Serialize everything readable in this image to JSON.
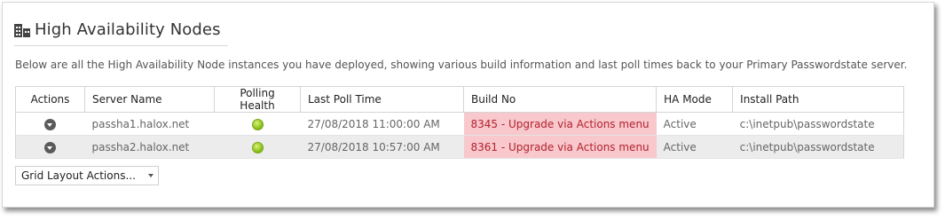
{
  "header": {
    "title": "High Availability Nodes",
    "icon": "building-icon"
  },
  "description": "Below are all the High Availability Node instances you have deployed, showing various build information and last poll times back to your Primary Passwordstate server.",
  "grid": {
    "columns": [
      "Actions",
      "Server Name",
      "Polling Health",
      "Last Poll Time",
      "Build No",
      "HA Mode",
      "Install Path"
    ],
    "rows": [
      {
        "server": "passha1.halox.net",
        "health": "healthy",
        "last_poll": "27/08/2018 11:00:00 AM",
        "build": "8345 - Upgrade via Actions menu",
        "mode": "Active",
        "path": "c:\\inetpub\\passwordstate"
      },
      {
        "server": "passha2.halox.net",
        "health": "healthy",
        "last_poll": "27/08/2018 10:57:00 AM",
        "build": "8361 - Upgrade via Actions menu",
        "mode": "Active",
        "path": "c:\\inetpub\\passwordstate"
      }
    ]
  },
  "grid_layout": {
    "label": "Grid Layout Actions..."
  },
  "colors": {
    "warning_bg": "#f8c8cc",
    "warning_text": "#b2222f",
    "health_ok": "#8cc31a"
  }
}
